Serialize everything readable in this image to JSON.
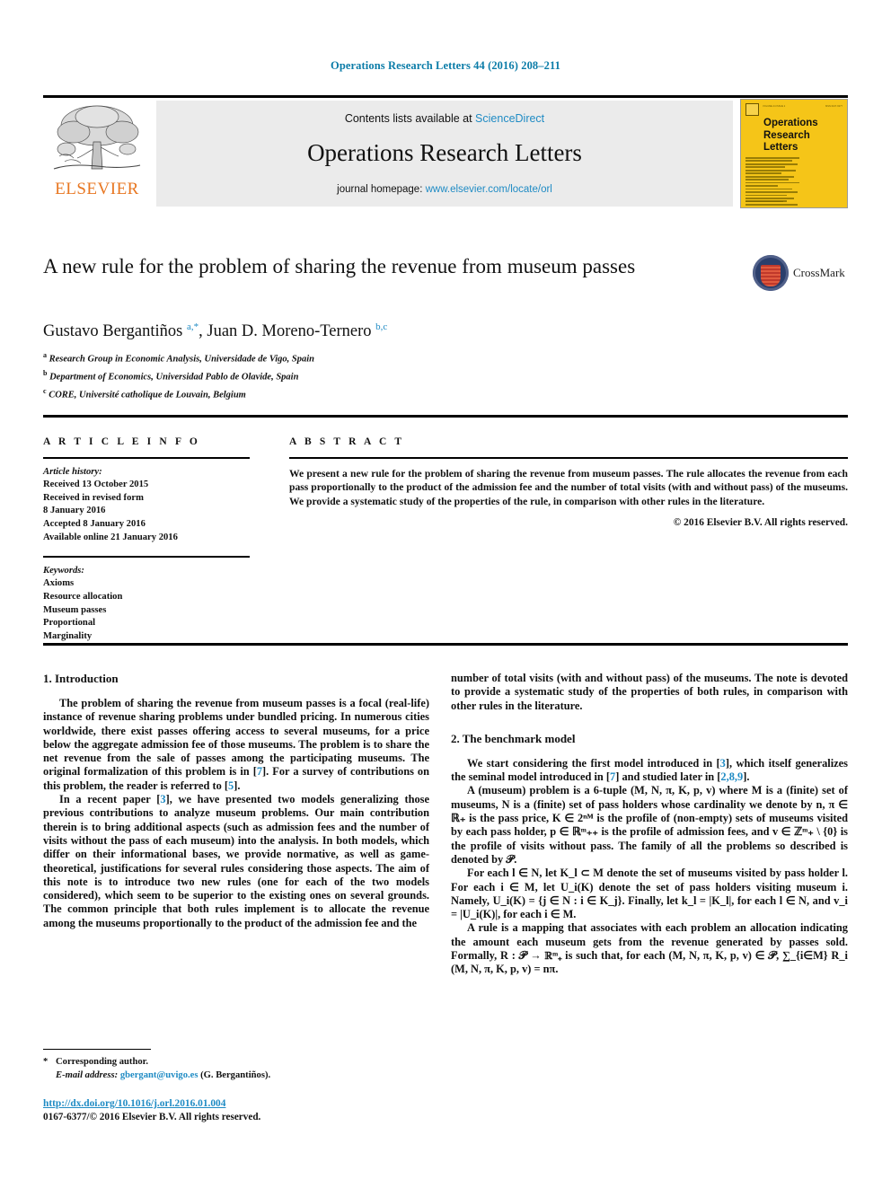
{
  "running_head": "Operations Research Letters 44 (2016) 208–211",
  "banner": {
    "contents_prefix": "Contents lists available at ",
    "sciencedirect": "ScienceDirect",
    "journal_title": "Operations Research Letters",
    "homepage_prefix": "journal homepage: ",
    "homepage_url": "www.elsevier.com/locate/orl",
    "publisher_logo_text": "ELSEVIER",
    "cover_title_line1": "Operations",
    "cover_title_line2": "Research",
    "cover_title_line3": "Letters"
  },
  "article": {
    "title": "A new rule for the problem of sharing the revenue from museum passes",
    "crossmark_label": "CrossMark",
    "authors_html": "Gustavo Bergantiños <sup>a,*</sup>, Juan D. Moreno-Ternero <sup>b,c</sup>",
    "affiliations": [
      {
        "marker": "a",
        "text": "Research Group in Economic Analysis, Universidade de Vigo, Spain"
      },
      {
        "marker": "b",
        "text": "Department of Economics, Universidad Pablo de Olavide, Spain"
      },
      {
        "marker": "c",
        "text": "CORE, Université catholique de Louvain, Belgium"
      }
    ]
  },
  "article_info": {
    "heading": "A R T I C L E  I N F O",
    "history_label": "Article history:",
    "history": [
      "Received 13 October 2015",
      "Received in revised form",
      "8 January 2016",
      "Accepted 8 January 2016",
      "Available online 21 January 2016"
    ],
    "keywords_label": "Keywords:",
    "keywords": [
      "Axioms",
      "Resource allocation",
      "Museum passes",
      "Proportional",
      "Marginality"
    ]
  },
  "abstract": {
    "heading": "A B S T R A C T",
    "text": "We present a new rule for the problem of sharing the revenue from museum passes. The rule allocates the revenue from each pass proportionally to the product of the admission fee and the number of total visits (with and without pass) of the museums. We provide a systematic study of the properties of the rule, in comparison with other rules in the literature.",
    "copyright": "© 2016 Elsevier B.V. All rights reserved."
  },
  "sections": {
    "introduction_heading": "1. Introduction",
    "benchmark_heading": "2. The benchmark model"
  },
  "body": {
    "intro_p1_a": "The problem of sharing the revenue from museum passes is a focal (real-life) instance of revenue sharing problems under bundled pricing. In numerous cities worldwide, there exist passes offering access to several museums, for a price below the aggregate admission fee of those museums. The problem is to share the net revenue from the sale of passes among the participating museums. The original formalization of this problem is in [",
    "intro_p1_cite1": "7",
    "intro_p1_b": "]. For a survey of contributions on this problem, the reader is referred to [",
    "intro_p1_cite2": "5",
    "intro_p1_c": "].",
    "intro_p2_a": "In a recent paper [",
    "intro_p2_cite1": "3",
    "intro_p2_b": "], we have presented two models generalizing those previous contributions to analyze museum problems. Our main contribution therein is to bring additional aspects (such as admission fees and the number of visits without the pass of each museum) into the analysis. In both models, which differ on their informational bases, we provide normative, as well as game-theoretical, justifications for several rules considering those aspects. The aim of this note is to introduce two new rules (one for each of the two models considered), which seem to be superior to the existing ones on several grounds. The common principle that both rules implement is to allocate the revenue among the museums proportionally to the product of the admission fee and the",
    "right_p1": "number of total visits (with and without pass) of the museums. The note is devoted to provide a systematic study of the properties of both rules, in comparison with other rules in the literature.",
    "bench_p1_a": "We start considering the first model introduced in [",
    "bench_p1_cite1": "3",
    "bench_p1_b": "], which itself generalizes the seminal model introduced in [",
    "bench_p1_cite2": "7",
    "bench_p1_c": "] and studied later in [",
    "bench_p1_cite3": "2,8,9",
    "bench_p1_d": "].",
    "bench_p2": "A (museum) problem is a 6-tuple (M, N, π, K, p, v) where M is a (finite) set of museums, N is a (finite) set of pass holders whose cardinality we denote by n, π ∈ ℝ₊ is the pass price, K ∈ 2ⁿᴹ is the profile of (non-empty) sets of museums visited by each pass holder, p ∈ ℝᵐ₊₊ is the profile of admission fees, and v ∈ ℤᵐ₊ \\ {0} is the profile of visits without pass. The family of all the problems so described is denoted by 𝒫.",
    "bench_p3": "For each l ∈ N, let K_l ⊂ M denote the set of museums visited by pass holder l. For each i ∈ M, let U_i(K) denote the set of pass holders visiting museum i. Namely, U_i(K) = {j ∈ N : i ∈ K_j}. Finally, let k_l = |K_l|, for each l ∈ N, and v_i = |U_i(K)|, for each i ∈ M.",
    "bench_p4": "A rule is a mapping that associates with each problem an allocation indicating the amount each museum gets from the revenue generated by passes sold. Formally, R : 𝒫 → ℝᵐ₊ is such that, for each (M, N, π, K, p, v) ∈ 𝒫, ∑_{i∈M} R_i (M, N, π, K, p, v) = nπ."
  },
  "footnote": {
    "corresponding_author": "Corresponding author.",
    "email_label": "E-mail address:",
    "email": "gbergant@uvigo.es",
    "email_suffix": "(G. Bergantiños).",
    "doi": "http://dx.doi.org/10.1016/j.orl.2016.01.004",
    "issn": "0167-6377/© 2016 Elsevier B.V. All rights reserved."
  },
  "colors": {
    "link_blue": "#1f8bc4",
    "running_head_blue": "#0b7ca8",
    "elsevier_orange": "#E87722",
    "cover_yellow": "#f5c518",
    "banner_gray": "#ebebeb"
  }
}
